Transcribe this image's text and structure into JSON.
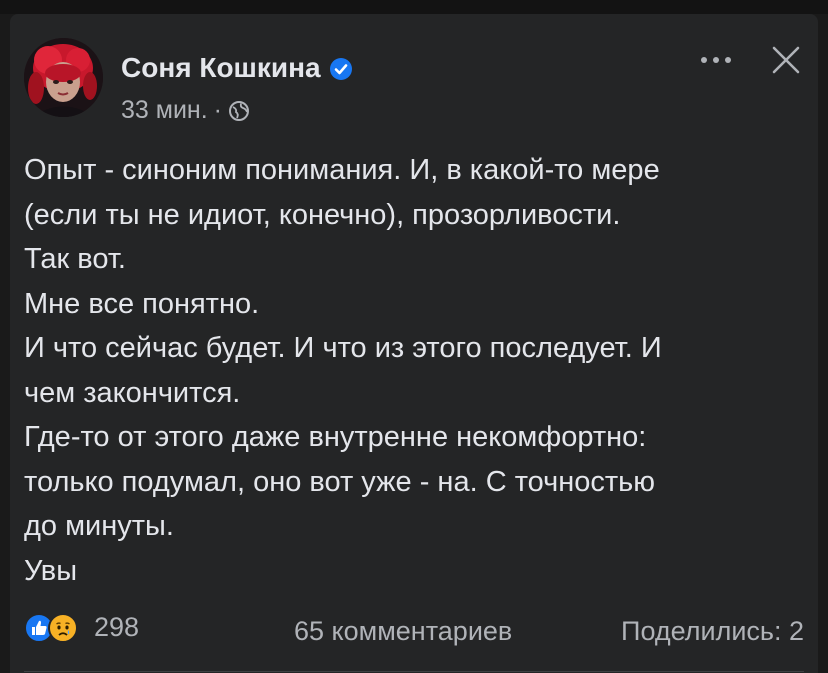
{
  "post": {
    "author": "Соня Кошкина",
    "time": "33 мин.",
    "separator": "·",
    "text_lines": [
      "Опыт - синоним понимания. И, в какой-то мере",
      "(если ты не идиот, конечно), прозорливости.",
      "Так вот.",
      "Мне все понятно.",
      "И что сейчас будет. И что из этого последует. И",
      "чем закончится.",
      "Где-то от этого даже внутренне некомфортно:",
      "только подумал, оно вот уже - на. С точностью",
      "до минуты.",
      "Увы"
    ]
  },
  "footer": {
    "reaction_count": "298",
    "comments": "65 комментариев",
    "shares": "Поделились: 2"
  },
  "icons": {
    "verified": "verified-badge-icon",
    "audience": "globe-icon",
    "more": "more-options-icon",
    "close": "close-icon",
    "reactions": [
      "like-reaction-icon",
      "sad-reaction-icon"
    ]
  },
  "colors": {
    "background": "#242526",
    "text_primary": "#e4e6eb",
    "text_secondary": "#b0b3b8",
    "verified_blue": "#1877f2",
    "like_blue": "#1877f2",
    "sad_yellow": "#f7b125"
  }
}
